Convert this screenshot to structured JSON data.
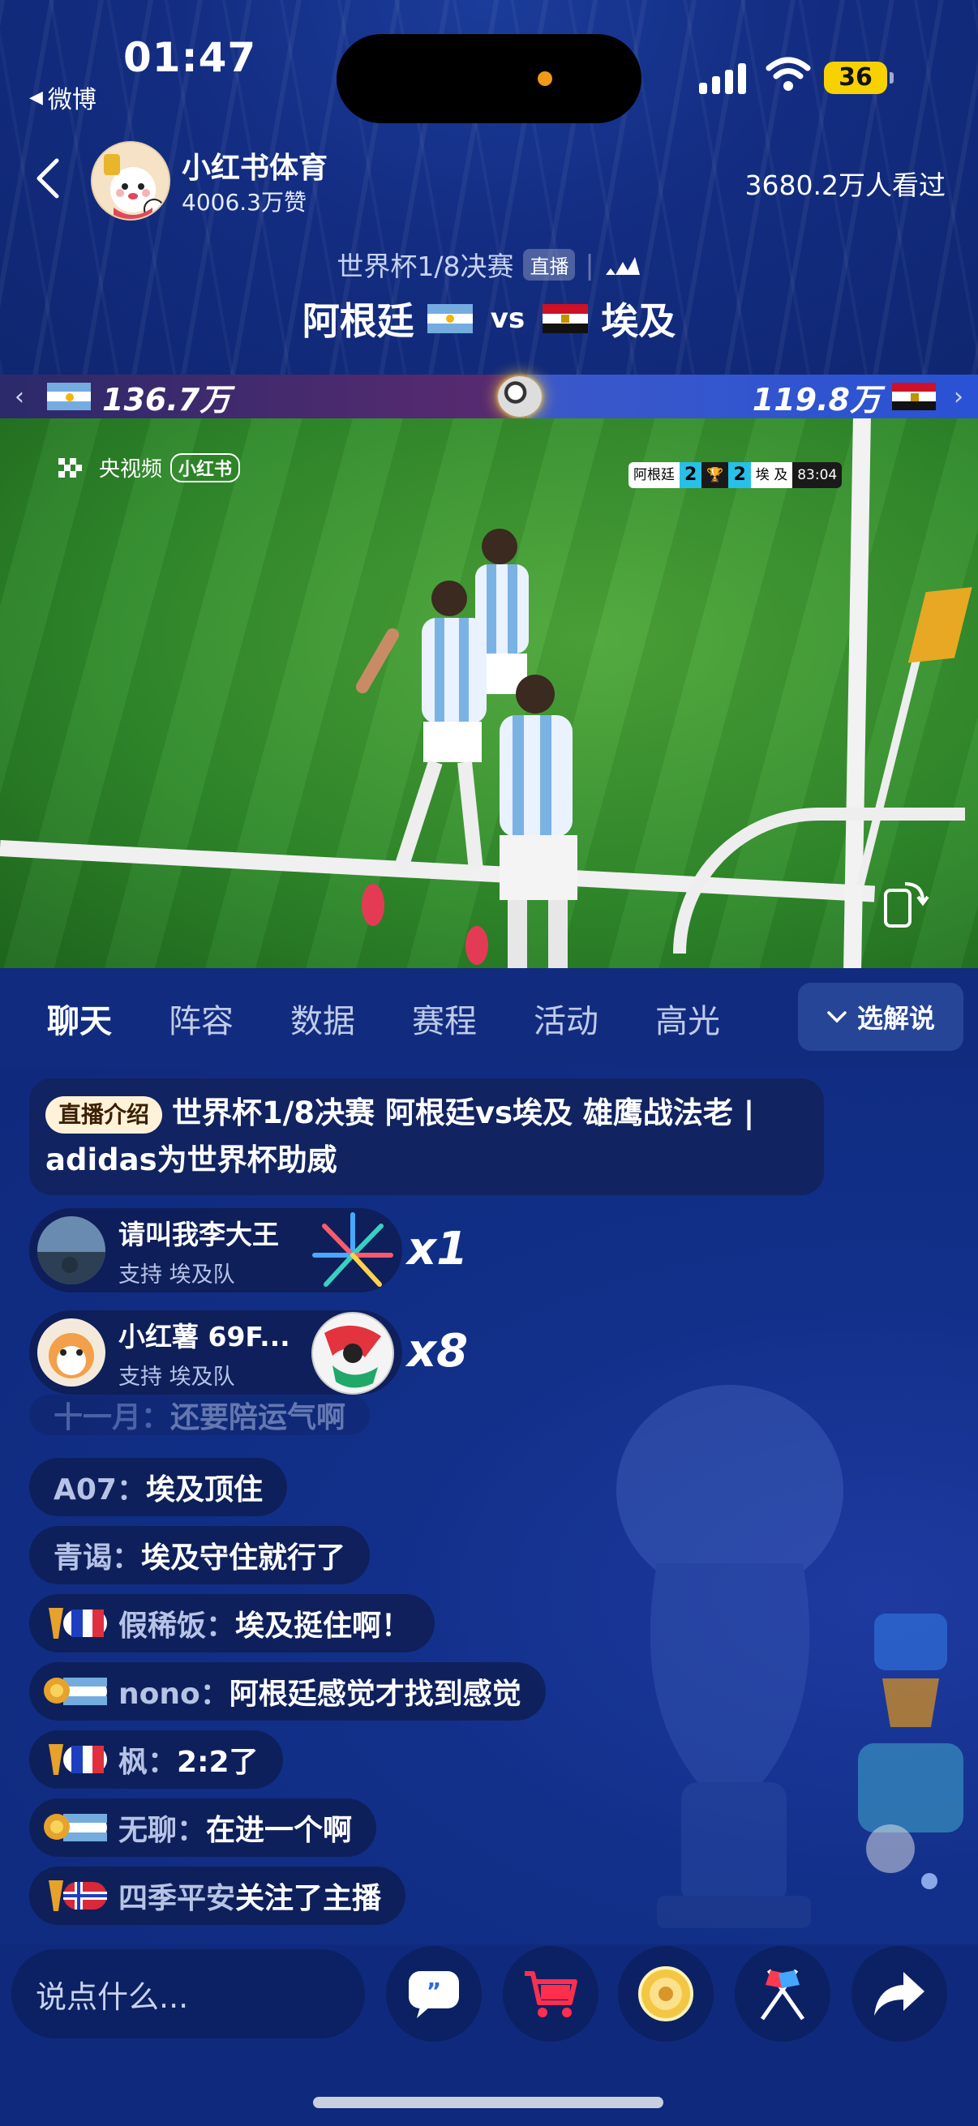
{
  "status": {
    "time": "01:47",
    "back_app": "微博",
    "battery": "36"
  },
  "header": {
    "anchor_name": "小红书体育",
    "anchor_likes": "4006.3万赞",
    "viewers": "3680.2万人看过",
    "match_title": "世界杯1/8决赛",
    "live_badge": "直播",
    "team_home": "阿根廷",
    "vs": "vs",
    "team_away": "埃及"
  },
  "support": {
    "home_value": "136.7万",
    "away_value": "119.8万"
  },
  "video": {
    "watermark": "央视频",
    "watermark_tag": "小红书",
    "scoreboard": {
      "home": "阿根廷",
      "home_score": "2",
      "away_score": "2",
      "away": "埃 及",
      "clock": "83:04"
    }
  },
  "tabs": {
    "items": [
      "聊天",
      "阵容",
      "数据",
      "赛程",
      "活动",
      "高光"
    ],
    "active": "聊天",
    "commentary_button": "选解说"
  },
  "intro": {
    "tag": "直播介绍",
    "text": "世界杯1/8决赛 阿根廷vs埃及 雄鹰战法老 | adidas为世界杯助威"
  },
  "gifts": [
    {
      "name": "请叫我李大王",
      "support": "支持 埃及队",
      "count": "x1",
      "icon": "fireworks-icon"
    },
    {
      "name": "小红薯 69F...",
      "support": "支持 埃及队",
      "count": "x8",
      "icon": "soccer-ball-icon"
    }
  ],
  "faded_message": {
    "user": "十一月：",
    "text": "还要陪运气啊"
  },
  "messages": [
    {
      "user": "A07：",
      "text": "埃及顶住",
      "badge": ""
    },
    {
      "user": "青谒：",
      "text": "埃及守住就行了",
      "badge": ""
    },
    {
      "user": "假稀饭：",
      "text": "埃及挺住啊！",
      "badge": "france"
    },
    {
      "user": "nono：",
      "text": "阿根廷感觉才找到感觉",
      "badge": "argentina"
    },
    {
      "user": "枫：",
      "text": "2:2了",
      "badge": "france"
    },
    {
      "user": "无聊：",
      "text": "在进一个啊",
      "badge": "argentina"
    },
    {
      "user": "四季平安",
      "text": " 关注了主播",
      "badge": "norway"
    }
  ],
  "bottom": {
    "input_placeholder": "说点什么...",
    "buttons": [
      "chat-bubble-icon",
      "shopping-cart-icon",
      "coin-icon",
      "flags-icon",
      "share-icon"
    ]
  },
  "colors": {
    "background": "#10297a",
    "argentina_blue": "#74acdf",
    "egypt_red": "#ce1126",
    "accent_gold": "#f7d200"
  }
}
